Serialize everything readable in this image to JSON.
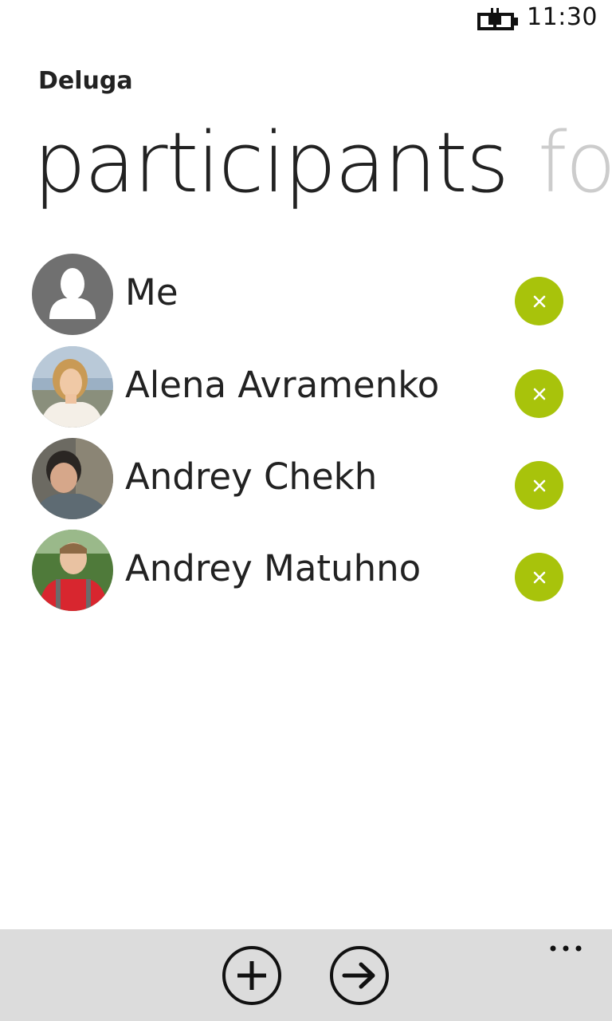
{
  "status_bar": {
    "time": "11:30",
    "battery_icon": "battery-charging-icon"
  },
  "app": {
    "title": "Deluga"
  },
  "pivot": {
    "active_label": "participants",
    "next_label": "fo"
  },
  "participants": [
    {
      "name": "Me",
      "avatar": "default-person-icon",
      "remove_icon": "close-icon"
    },
    {
      "name": "Alena Avramenko",
      "avatar": "photo",
      "remove_icon": "close-icon"
    },
    {
      "name": "Andrey Chekh",
      "avatar": "photo",
      "remove_icon": "close-icon"
    },
    {
      "name": "Andrey Matuhno",
      "avatar": "photo",
      "remove_icon": "close-icon"
    }
  ],
  "app_bar": {
    "buttons": [
      {
        "icon": "add-icon"
      },
      {
        "icon": "arrow-right-icon"
      }
    ],
    "more_icon": "ellipsis-icon"
  },
  "colors": {
    "accent": "#a8c30b",
    "app_bar_bg": "#dcdcdc",
    "text": "#222222",
    "inactive_pivot": "#cccccc"
  }
}
